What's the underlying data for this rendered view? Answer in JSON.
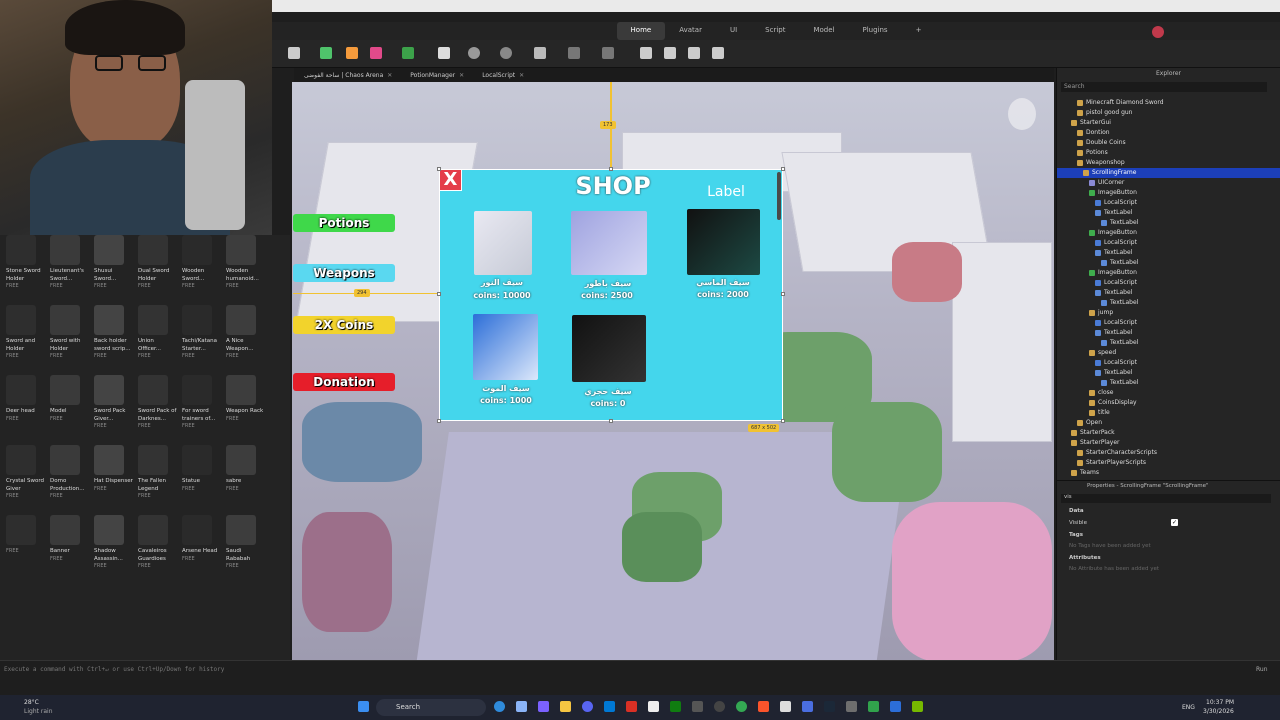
{
  "studio": {
    "menu_tabs": [
      "Home",
      "Avatar",
      "UI",
      "Script",
      "Model",
      "Plugins",
      "+"
    ],
    "active_menu_tab": "Home",
    "doc_tabs": [
      {
        "label": "ساحة الفوضى | Chaos Arena"
      },
      {
        "label": "PotionManager"
      },
      {
        "label": "LocalScript"
      }
    ]
  },
  "toolbox": {
    "items": [
      {
        "name": "Stone Sword Holder",
        "price": "FREE"
      },
      {
        "name": "Lieutenant's Sword...",
        "price": "FREE"
      },
      {
        "name": "Shusui Sword...",
        "price": "FREE"
      },
      {
        "name": "Dual Sword Holder",
        "price": "FREE"
      },
      {
        "name": "Wooden Sword...",
        "price": "FREE"
      },
      {
        "name": "Wooden humanoid...",
        "price": "FREE"
      },
      {
        "name": "Sword and Holder",
        "price": "FREE"
      },
      {
        "name": "Sword with Holder",
        "price": "FREE"
      },
      {
        "name": "Back holder sword scrip...",
        "price": "FREE"
      },
      {
        "name": "Union Officer...",
        "price": "FREE"
      },
      {
        "name": "Tachi/Katana Starter...",
        "price": "FREE"
      },
      {
        "name": "A Nice Weapon...",
        "price": "FREE"
      },
      {
        "name": "Deer head",
        "price": "FREE"
      },
      {
        "name": "Model",
        "price": "FREE"
      },
      {
        "name": "Sword Pack Giver...",
        "price": "FREE"
      },
      {
        "name": "Sword Pack of Darknes...",
        "price": "FREE"
      },
      {
        "name": "For sword trainers of...",
        "price": "FREE"
      },
      {
        "name": "Weapon Rack",
        "price": "FREE"
      },
      {
        "name": "Crystal Sword Giver",
        "price": "FREE"
      },
      {
        "name": "Domo Production...",
        "price": "FREE"
      },
      {
        "name": "Hat Dispenser",
        "price": "FREE"
      },
      {
        "name": "The Fallen Legend",
        "price": "FREE"
      },
      {
        "name": "Statue",
        "price": "FREE"
      },
      {
        "name": "sabre",
        "price": "FREE"
      },
      {
        "name": "",
        "price": "FREE"
      },
      {
        "name": "Banner",
        "price": "FREE"
      },
      {
        "name": "Shadow Assassin...",
        "price": "FREE"
      },
      {
        "name": "Cavaleiros Guardioes",
        "price": "FREE"
      },
      {
        "name": "Arsene Head",
        "price": "FREE"
      },
      {
        "name": "Saudi Rababah",
        "price": "FREE"
      }
    ]
  },
  "side_buttons": [
    {
      "label": "Potions",
      "color": "#3fd84a"
    },
    {
      "label": "Weapons",
      "color": "#5ad8f0"
    },
    {
      "label": "2X Coins",
      "color": "#f2d32c"
    },
    {
      "label": "Donation",
      "color": "#e61e2a"
    }
  ],
  "shop": {
    "title": "SHOP",
    "label": "Label",
    "close_symbol": "X",
    "items": [
      {
        "name": "سيف النور",
        "price": "coins: 10000"
      },
      {
        "name": "سيف باطور",
        "price": "coins: 2500"
      },
      {
        "name": "سيف الماسي",
        "price": "coins: 2000"
      },
      {
        "name": "سيف الموت",
        "price": "coins: 1000"
      },
      {
        "name": "سيف حجري",
        "price": "coins: 0"
      }
    ],
    "dim_top": "173",
    "dim_left": "294",
    "dim_size": "687 x 502"
  },
  "explorer": {
    "title": "Explorer",
    "search_placeholder": "Search",
    "rows": [
      {
        "label": "Minecraft Diamond Sword",
        "indent": 2
      },
      {
        "label": "pistol good gun",
        "indent": 2
      },
      {
        "label": "StarterGui",
        "indent": 1
      },
      {
        "label": "Dontion",
        "indent": 2
      },
      {
        "label": "Double Coins",
        "indent": 2
      },
      {
        "label": "Potions",
        "indent": 2
      },
      {
        "label": "Weaponshop",
        "indent": 2
      },
      {
        "label": "ScrollingFrame",
        "indent": 3,
        "selected": true
      },
      {
        "label": "UICorner",
        "indent": 4
      },
      {
        "label": "ImageButton",
        "indent": 4
      },
      {
        "label": "LocalScript",
        "indent": 5
      },
      {
        "label": "TextLabel",
        "indent": 5
      },
      {
        "label": "TextLabel",
        "indent": 6
      },
      {
        "label": "ImageButton",
        "indent": 4
      },
      {
        "label": "LocalScript",
        "indent": 5
      },
      {
        "label": "TextLabel",
        "indent": 5
      },
      {
        "label": "TextLabel",
        "indent": 6
      },
      {
        "label": "ImageButton",
        "indent": 4
      },
      {
        "label": "LocalScript",
        "indent": 5
      },
      {
        "label": "TextLabel",
        "indent": 5
      },
      {
        "label": "TextLabel",
        "indent": 6
      },
      {
        "label": "jump",
        "indent": 4
      },
      {
        "label": "LocalScript",
        "indent": 5
      },
      {
        "label": "TextLabel",
        "indent": 5
      },
      {
        "label": "TextLabel",
        "indent": 6
      },
      {
        "label": "speed",
        "indent": 4
      },
      {
        "label": "LocalScript",
        "indent": 5
      },
      {
        "label": "TextLabel",
        "indent": 5
      },
      {
        "label": "TextLabel",
        "indent": 6
      },
      {
        "label": "close",
        "indent": 4
      },
      {
        "label": "CoinsDisplay",
        "indent": 4
      },
      {
        "label": "title",
        "indent": 4
      },
      {
        "label": "Open",
        "indent": 2
      },
      {
        "label": "StarterPack",
        "indent": 1
      },
      {
        "label": "StarterPlayer",
        "indent": 1
      },
      {
        "label": "StarterCharacterScripts",
        "indent": 2
      },
      {
        "label": "StarterPlayerScripts",
        "indent": 2
      },
      {
        "label": "Teams",
        "indent": 1
      }
    ]
  },
  "properties": {
    "title": "Properties - ScrollingFrame \"ScrollingFrame\"",
    "filter": "vis",
    "data_section": "Data",
    "visible_label": "Visible",
    "tags_section": "Tags",
    "tags_empty": "No Tags have been added yet",
    "attributes_section": "Attributes",
    "attributes_empty": "No Attribute has been added yet"
  },
  "command_bar": {
    "placeholder": "Execute a command with Ctrl+↵ or use Ctrl+Up/Down for history",
    "run_label": "Run"
  },
  "taskbar": {
    "weather_temp": "28°C",
    "weather_desc": "Light rain",
    "search_label": "Search",
    "lang": "ENG",
    "time": "10:37 PM",
    "date": "3/30/2026"
  }
}
